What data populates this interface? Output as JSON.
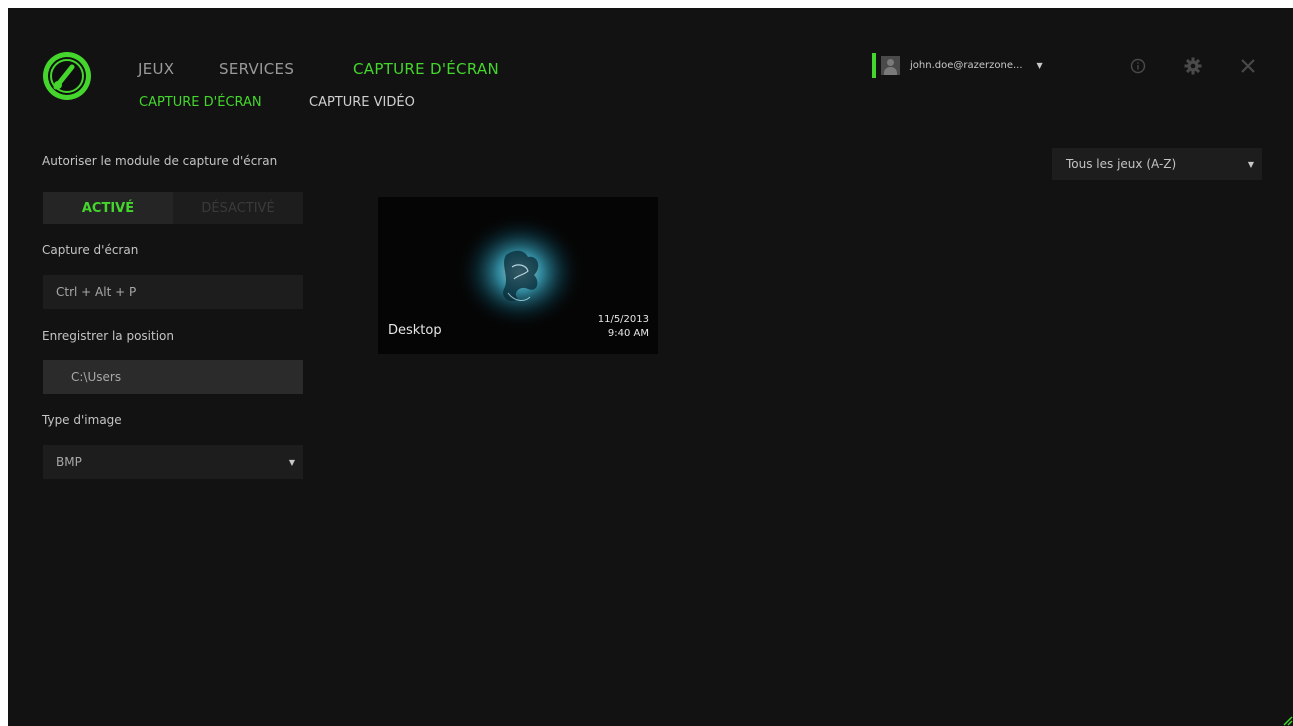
{
  "nav": {
    "main": [
      {
        "label": "JEUX"
      },
      {
        "label": "SERVICES"
      },
      {
        "label": "CAPTURE D'ÉCRAN"
      }
    ],
    "sub": [
      {
        "label": "CAPTURE D'ÉCRAN"
      },
      {
        "label": "CAPTURE VIDÉO"
      }
    ]
  },
  "user": {
    "name": "john.doe@razerzone...",
    "caret": "▼"
  },
  "settings": {
    "enable_label": "Autoriser le module de capture d'écran",
    "toggle_on": "ACTIVÉ",
    "toggle_off": "DÉSACTIVÉ",
    "hotkey_label": "Capture d'écran",
    "hotkey_value": "Ctrl + Alt + P",
    "location_label": "Enregistrer la position",
    "location_value": "C:\\Users",
    "image_type_label": "Type d'image",
    "image_type_value": "BMP",
    "caret": "▼"
  },
  "sort": {
    "value": "Tous les jeux (A-Z)",
    "caret": "▼"
  },
  "screenshots": [
    {
      "title": "Desktop",
      "date": "11/5/2013",
      "time": "9:40 AM"
    }
  ],
  "colors": {
    "accent": "#44d62c",
    "background": "#121212"
  },
  "icons": [
    "game-booster-logo",
    "user-avatar-icon",
    "info-icon",
    "gear-icon",
    "close-icon",
    "resize-corner-icon"
  ]
}
